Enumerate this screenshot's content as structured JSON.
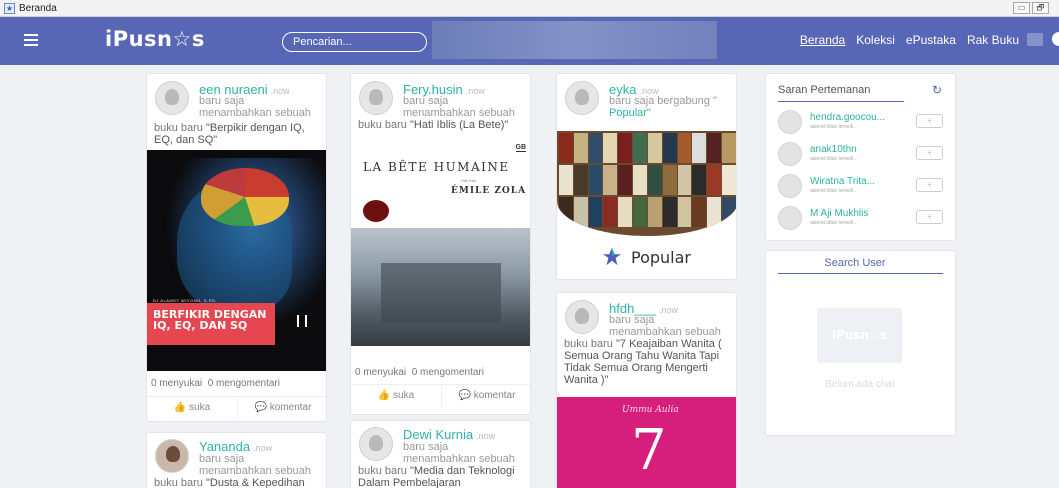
{
  "window": {
    "title": "Beranda",
    "buttons": [
      "▭",
      "🗗"
    ]
  },
  "nav": {
    "brand": "iPusn☆s",
    "search_placeholder": "Pencarian...",
    "links": [
      "Beranda",
      "Koleksi",
      "ePustaka",
      "Rak Buku"
    ],
    "active": "Beranda"
  },
  "colors": {
    "nav": "#5866b6",
    "accent": "#2db3a7",
    "background": "#f0f1f5"
  },
  "feed": {
    "col1": [
      {
        "user": "een nuraeni",
        "time": ".now",
        "line1": "baru saja",
        "line2": "menambahkan sebuah",
        "prefix": "buku baru",
        "title": "\"Berpikir dengan IQ, EQ, dan SQ\"",
        "cover": {
          "small": "DJ ALAMSY WIYONO, S.PD.",
          "heading": "BERFIKIR DENGAN IQ, EQ, DAN SQ"
        },
        "likes": "0 menyukai",
        "comments": "0 mengomentari",
        "like_btn": "suka",
        "comment_btn": "komentar"
      },
      {
        "user": "Yananda",
        "time": ".now",
        "line1": "baru saja",
        "line2": "menambahkan sebuah",
        "prefix": "buku baru",
        "title": "\"Dusta & Kepedihan"
      }
    ],
    "col2": [
      {
        "user": "Fery.husin",
        "time": ".now",
        "line1": "baru saja",
        "line2": "menambahkan sebuah",
        "prefix": "buku baru",
        "title": "\"Hati Iblis (La Bete)\"",
        "cover": {
          "tag": "GB",
          "title": "LA BÊTE HUMAINE",
          "sub": "Hati Iblis",
          "author": "ÉMILE ZOLA"
        },
        "likes": "0 menyukai",
        "comments": "0 mengomentari",
        "like_btn": "suka",
        "comment_btn": "komentar"
      },
      {
        "user": "Dewi Kurnia",
        "time": ".now",
        "line1": "baru saja",
        "line2": "menambahkan sebuah",
        "prefix": "buku baru",
        "title": "\"Media dan Teknologi Dalam Pembelajaran"
      }
    ],
    "col3": [
      {
        "user": "eyka",
        "time": ".now",
        "line1": "baru saja bergabung \"",
        "line2": "Popular\"",
        "badge": "Popular"
      },
      {
        "user": "hfdh___",
        "time": ".now",
        "line1": "baru saja",
        "line2": "menambahkan sebuah",
        "prefix": "buku baru",
        "title": "\"7 Keajaiban Wanita ( Semua Orang Tahu Wanita Tapi Tidak Semua Orang Mengerti Wanita )\"",
        "cover": {
          "title": "Ummu Aulia",
          "num": "7"
        }
      }
    ]
  },
  "sidebar": {
    "friends_title": "Saran Pertemanan",
    "refresh_icon": "↻",
    "suggestions": [
      {
        "name": "hendra.goocou...",
        "sub": "alamat tidak tersedi..."
      },
      {
        "name": "anak10thn",
        "sub": "alamat tidak tersedi..."
      },
      {
        "name": "Wiratna Trita...",
        "sub": "alamat tidak tersedi..."
      },
      {
        "name": "M Aji Mukhlis",
        "sub": "alamat tidak tersedi..."
      }
    ],
    "add_label": "+",
    "search_user": "Search User",
    "chat_logo": "iPusn☆s",
    "no_chat": "Belum ada chat"
  }
}
